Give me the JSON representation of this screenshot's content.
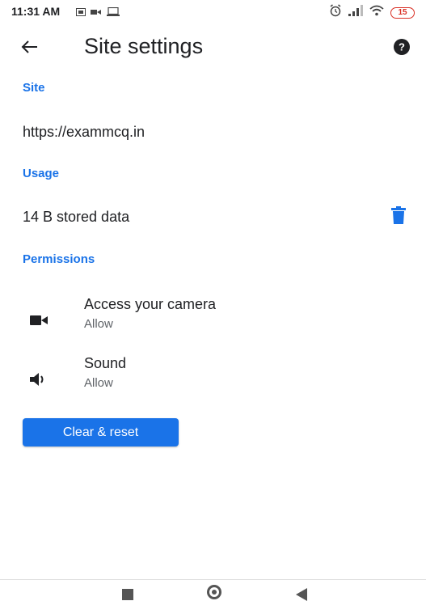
{
  "status_bar": {
    "time": "11:31 AM",
    "battery_level": "15",
    "battery_color": "#d93025",
    "icons": [
      "sim-card-icon",
      "video-call-icon",
      "laptop-icon",
      "alarm-icon",
      "signal-icon",
      "wifi-icon"
    ]
  },
  "app_bar": {
    "title": "Site settings",
    "back_icon": "arrow-back-icon",
    "help_icon": "help-icon"
  },
  "sections": {
    "site": {
      "header": "Site",
      "url": "https://exammcq.in"
    },
    "usage": {
      "header": "Usage",
      "stored_data": "14 B stored data",
      "delete_icon": "trash-icon"
    },
    "permissions": {
      "header": "Permissions",
      "items": [
        {
          "title": "Access your camera",
          "status": "Allow",
          "icon": "camera-icon"
        },
        {
          "title": "Sound",
          "status": "Allow",
          "icon": "speaker-icon"
        }
      ]
    }
  },
  "actions": {
    "clear_reset_label": "Clear & reset"
  },
  "colors": {
    "accent": "#1a73e8",
    "text_primary": "#202124",
    "text_secondary": "#5f6368"
  },
  "nav_bar": {
    "icons": [
      "recents-icon",
      "home-icon",
      "back-icon"
    ]
  }
}
